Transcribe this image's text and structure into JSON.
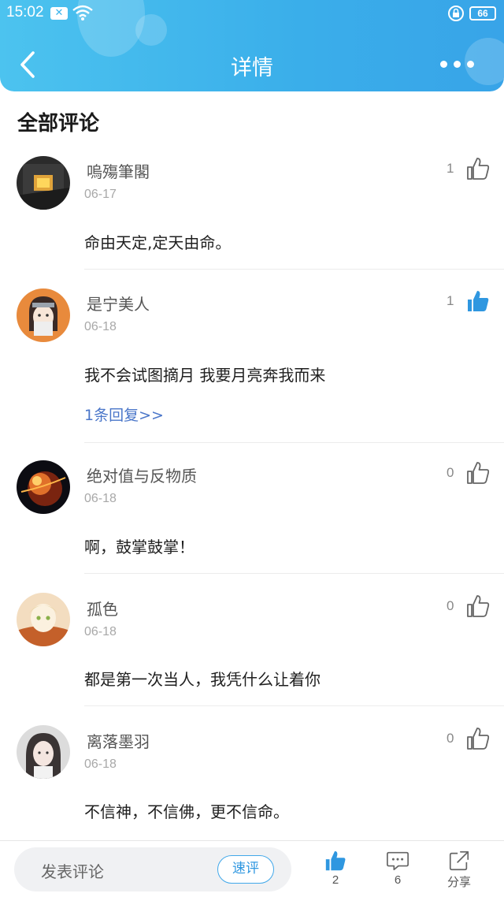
{
  "status_bar": {
    "time": "15:02",
    "battery": "66"
  },
  "header": {
    "title": "详情"
  },
  "section": {
    "title": "全部评论"
  },
  "comments": [
    {
      "username": "嗚殤筆閣",
      "date": "06-17",
      "likes": "1",
      "liked": false,
      "text": "命由天定,定天由命。",
      "reply": ""
    },
    {
      "username": "是宁美人",
      "date": "06-18",
      "likes": "1",
      "liked": true,
      "text": "我不会试图摘月 我要月亮奔我而来",
      "reply": "1条回复>>"
    },
    {
      "username": "绝对值与反物质",
      "date": "06-18",
      "likes": "0",
      "liked": false,
      "text": "啊，鼓掌鼓掌！",
      "reply": ""
    },
    {
      "username": "孤色",
      "date": "06-18",
      "likes": "0",
      "liked": false,
      "text": "都是第一次当人，我凭什么让着你",
      "reply": ""
    },
    {
      "username": "离落墨羽",
      "date": "06-18",
      "likes": "0",
      "liked": false,
      "text": "不信神，不信佛，更不信命。",
      "reply": ""
    }
  ],
  "bottom_bar": {
    "input_placeholder": "发表评论",
    "quick_comment": "速评",
    "like_count": "2",
    "comment_count": "6",
    "share_label": "分享"
  },
  "colors": {
    "accent": "#2f97e0",
    "header_start": "#4cc3ef",
    "header_end": "#38a4e8",
    "link": "#4a76c9"
  }
}
